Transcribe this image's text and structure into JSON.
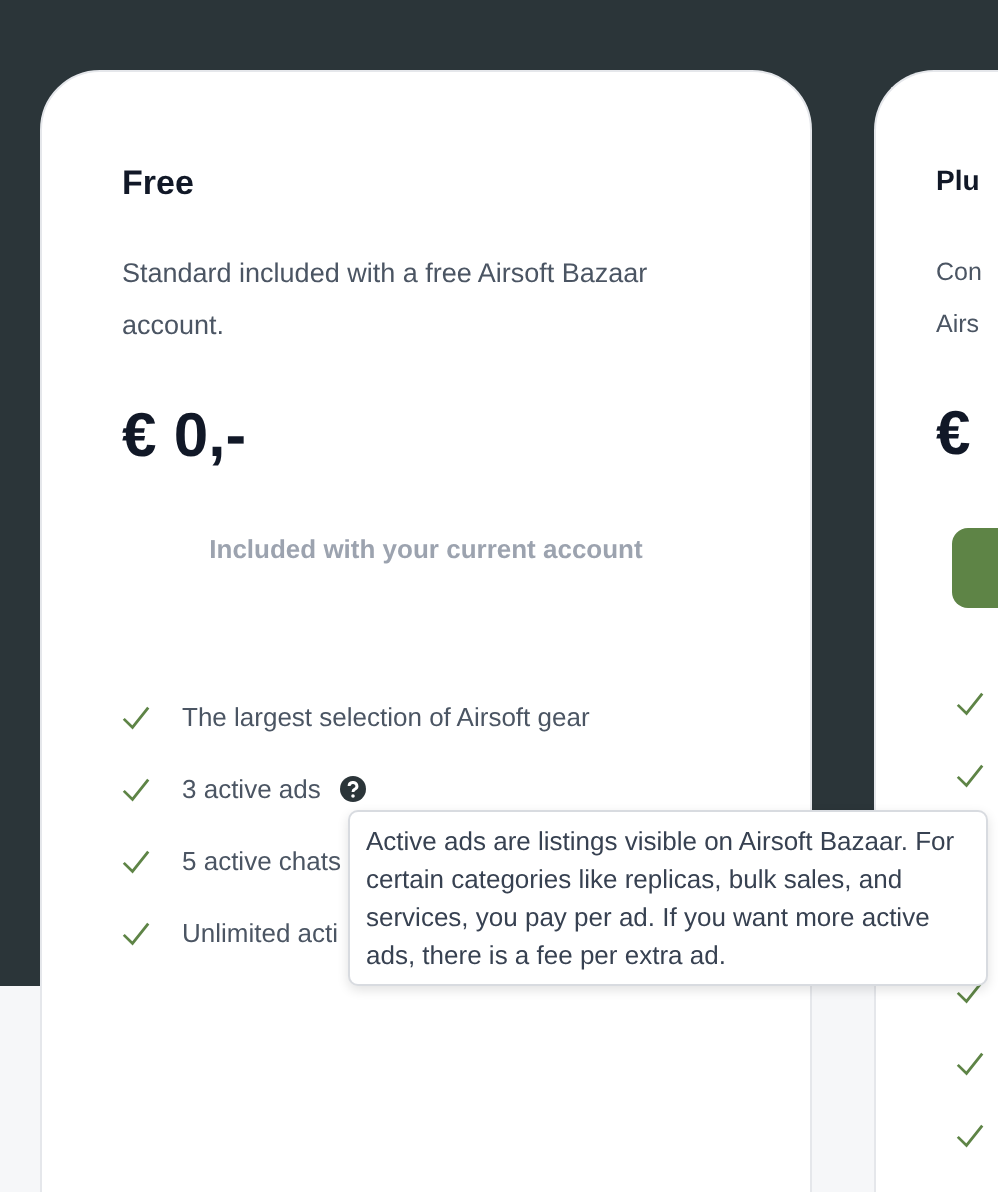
{
  "plans": [
    {
      "title": "Free",
      "description": "Standard included with a free Airsoft Bazaar account.",
      "price": "€ 0,-",
      "note": "Included with your current account",
      "features": [
        {
          "kind": "check",
          "label": "The largest selection of Airsoft gear",
          "help": false
        },
        {
          "kind": "check",
          "label": "3 active ads",
          "help": true
        },
        {
          "kind": "check",
          "label": "5 active chats",
          "help": false
        },
        {
          "kind": "check",
          "label": "Unlimited acti",
          "help": false
        }
      ]
    },
    {
      "title": "Plu",
      "description_lines": [
        "Con",
        "Airs"
      ],
      "price": "€",
      "button": true,
      "features": [
        {
          "kind": "check"
        },
        {
          "kind": "check"
        },
        {
          "kind": "covered"
        },
        {
          "kind": "covered"
        },
        {
          "kind": "check"
        },
        {
          "kind": "check"
        },
        {
          "kind": "check"
        }
      ]
    }
  ],
  "tooltip": "Active ads are listings visible on Airsoft Bazaar. For certain categories like replicas, bulk sales, and services, you pay per ad. If you want more active ads, there is a fee per extra ad."
}
